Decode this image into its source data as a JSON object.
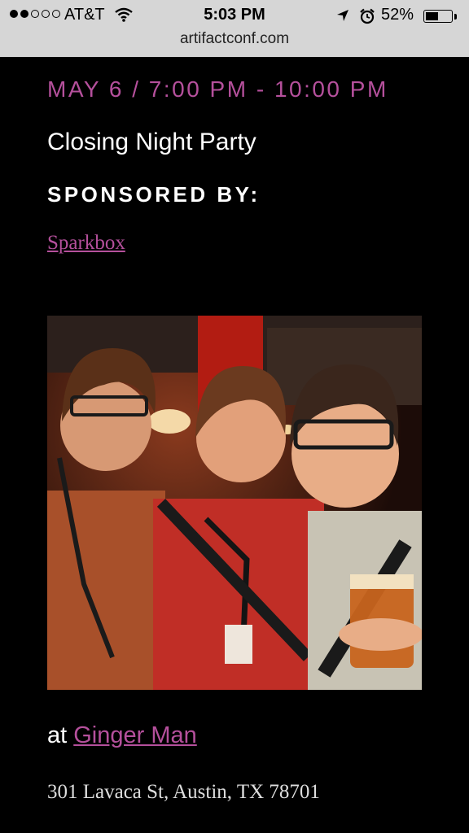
{
  "status_bar": {
    "carrier": "AT&T",
    "time": "5:03 PM",
    "battery_percent": "52%",
    "battery_level": 0.52,
    "signal_bars_filled": 2,
    "signal_bars_total": 5,
    "icons": [
      "wifi-icon",
      "location-arrow-icon",
      "alarm-clock-icon",
      "battery-icon"
    ]
  },
  "browser": {
    "url": "artifactconf.com"
  },
  "event": {
    "date_line": "MAY 6 / 7:00 PM - 10:00 PM",
    "title": "Closing Night Party",
    "sponsored_label": "SPONSORED BY:",
    "sponsor": "Sparkbox",
    "venue_prefix": "at",
    "venue_name": "Ginger Man",
    "address": "301 Lavaca St, Austin, TX 78701"
  },
  "colors": {
    "accent": "#b5509c",
    "background": "#000000",
    "status_bar_bg": "#d6d6d6"
  }
}
